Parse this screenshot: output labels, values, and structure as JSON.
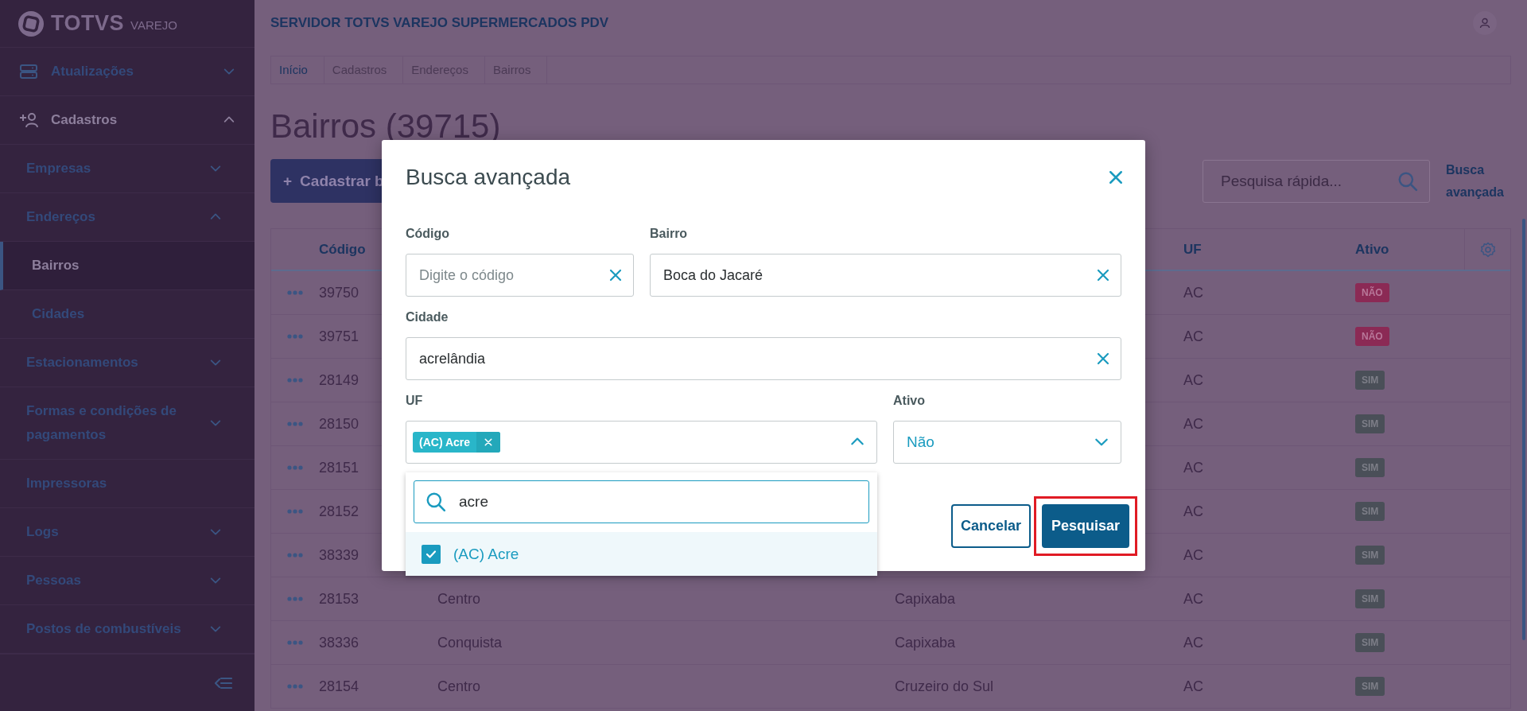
{
  "sidebar": {
    "logo": {
      "brand": "TOTVS",
      "product": "VAREJO"
    },
    "items": [
      {
        "label": "Atualizações",
        "kind": "group",
        "expanded": false
      },
      {
        "label": "Cadastros",
        "kind": "group",
        "expanded": true,
        "children": [
          {
            "label": "Empresas",
            "kind": "group",
            "expanded": false
          },
          {
            "label": "Endereços",
            "kind": "group",
            "expanded": true,
            "children": [
              {
                "label": "Bairros",
                "kind": "link",
                "selected": true
              },
              {
                "label": "Cidades",
                "kind": "link",
                "selected": false
              }
            ]
          },
          {
            "label": "Estacionamentos",
            "kind": "group",
            "expanded": false
          },
          {
            "label": "Formas e condições de pagamentos",
            "kind": "group",
            "expanded": false
          },
          {
            "label": "Impressoras",
            "kind": "link",
            "selected": false
          },
          {
            "label": "Logs",
            "kind": "group",
            "expanded": false
          },
          {
            "label": "Pessoas",
            "kind": "group",
            "expanded": false
          },
          {
            "label": "Postos de combustíveis",
            "kind": "group",
            "expanded": false
          }
        ]
      }
    ]
  },
  "header": {
    "title": "SERVIDOR TOTVS VAREJO SUPERMERCADOS PDV"
  },
  "breadcrumb": [
    {
      "label": "Início",
      "link": true
    },
    {
      "label": "Cadastros",
      "link": false
    },
    {
      "label": "Endereços",
      "link": false
    },
    {
      "label": "Bairros",
      "link": false
    }
  ],
  "page_title": "Bairros (39715)",
  "toolbar": {
    "add_button": {
      "icon": "+",
      "label": "Cadastrar b"
    },
    "quick_search": {
      "placeholder": "Pesquisa rápida..."
    },
    "advanced_search_link": "Busca avançada"
  },
  "table": {
    "columns": [
      "Código",
      "UF",
      "Ativo"
    ],
    "rows": [
      {
        "code": "39750",
        "uf": "AC",
        "ativo": {
          "label": "NÃO",
          "active": false
        }
      },
      {
        "code": "39751",
        "uf": "AC",
        "ativo": {
          "label": "NÃO",
          "active": false
        }
      },
      {
        "code": "28149",
        "uf": "AC",
        "ativo": {
          "label": "SIM",
          "active": true
        }
      },
      {
        "code": "28150",
        "uf": "AC",
        "ativo": {
          "label": "SIM",
          "active": true
        }
      },
      {
        "code": "28151",
        "uf": "AC",
        "ativo": {
          "label": "SIM",
          "active": true
        }
      },
      {
        "code": "28152",
        "uf": "AC",
        "ativo": {
          "label": "SIM",
          "active": true
        }
      },
      {
        "code": "38339",
        "uf": "AC",
        "ativo": {
          "label": "SIM",
          "active": true
        }
      },
      {
        "code": "28153",
        "bairro": "Centro",
        "cidade": "Capixaba",
        "uf": "AC",
        "ativo": {
          "label": "SIM",
          "active": true
        }
      },
      {
        "code": "38336",
        "bairro": "Conquista",
        "cidade": "Capixaba",
        "uf": "AC",
        "ativo": {
          "label": "SIM",
          "active": true
        }
      },
      {
        "code": "28154",
        "bairro": "Centro",
        "cidade": "Cruzeiro do Sul",
        "uf": "AC",
        "ativo": {
          "label": "SIM",
          "active": true
        }
      }
    ]
  },
  "modal": {
    "title": "Busca avançada",
    "fields": [
      {
        "label": "Código",
        "kind": "text",
        "placeholder": "Digite o código"
      },
      {
        "label": "Bairro",
        "kind": "text",
        "value": "Boca do Jacaré"
      },
      {
        "label": "Cidade",
        "kind": "text",
        "value": "acrelândia"
      },
      {
        "label": "UF",
        "kind": "multiselect",
        "tags": [
          "(AC) Acre"
        ],
        "expanded": true,
        "search": {
          "value": "acre"
        },
        "options": [
          {
            "label": "(AC) Acre",
            "checked": true
          }
        ]
      },
      {
        "label": "Ativo",
        "kind": "select",
        "value": "Não",
        "expanded": false
      }
    ],
    "buttons": [
      {
        "label": "Cancelar",
        "kind": "secondary",
        "highlighted": false
      },
      {
        "label": "Pesquisar",
        "kind": "primary",
        "highlighted": true
      }
    ]
  }
}
